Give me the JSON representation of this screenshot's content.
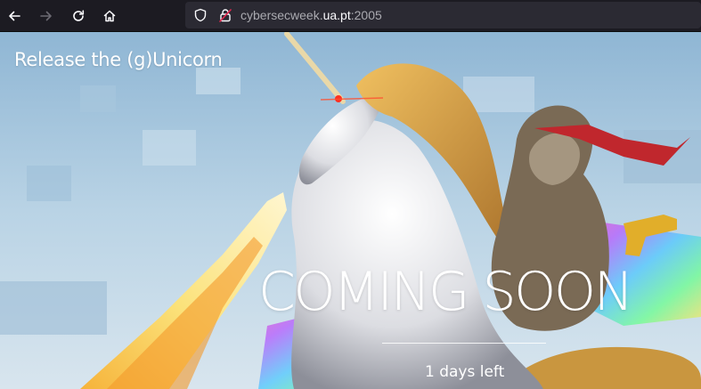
{
  "browser": {
    "url_prefix": "cybersecweek.",
    "url_host": "ua.pt",
    "url_suffix": ":2005"
  },
  "page": {
    "brand": "Release the (g)Unicorn",
    "headline": "COMING SOON",
    "countdown": "1 days left"
  },
  "colors": {
    "toolbar": "#1c1b22",
    "urlbar": "#2b2a33",
    "text_on_hero": "#ffffff"
  },
  "icons": [
    "back-arrow-icon",
    "forward-arrow-icon",
    "reload-icon",
    "home-icon",
    "shield-icon",
    "lock-warning-icon"
  ]
}
